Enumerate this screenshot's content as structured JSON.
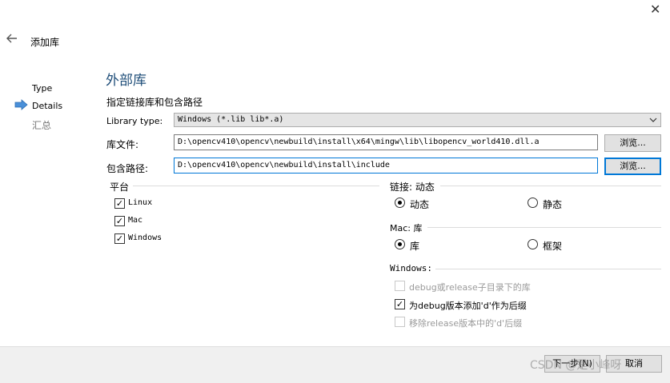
{
  "window": {
    "close_glyph": "✕",
    "title": "添加库",
    "back_glyph": "🡐"
  },
  "steps": [
    {
      "label": "Type"
    },
    {
      "label": "Details"
    },
    {
      "label": "汇总"
    }
  ],
  "page": {
    "heading": "外部库",
    "subtitle": "指定链接库和包含路径"
  },
  "library_type": {
    "label": "Library type:",
    "value": "Windows (*.lib lib*.a)"
  },
  "library_file": {
    "label": "库文件:",
    "value": "D:\\opencv410\\opencv\\newbuild\\install\\x64\\mingw\\lib\\libopencv_world410.dll.a",
    "browse": "浏览..."
  },
  "include_path": {
    "label": "包含路径:",
    "value": "D:\\opencv410\\opencv\\newbuild\\install\\include",
    "browse": "浏览..."
  },
  "platform": {
    "title": "平台",
    "items": [
      {
        "label": "Linux",
        "checked": true
      },
      {
        "label": "Mac",
        "checked": true
      },
      {
        "label": "Windows",
        "checked": true
      }
    ]
  },
  "linkage": {
    "title": "链接: 动态",
    "options": [
      {
        "label": "动态",
        "selected": true
      },
      {
        "label": "静态",
        "selected": false
      }
    ]
  },
  "mac": {
    "title": "Mac: 库",
    "options": [
      {
        "label": "库",
        "selected": true
      },
      {
        "label": "框架",
        "selected": false
      }
    ]
  },
  "windows_opts": {
    "title": "Windows:",
    "items": [
      {
        "label": "debug或release子目录下的库",
        "checked": false,
        "enabled": false
      },
      {
        "label": "为debug版本添加'd'作为后缀",
        "checked": true,
        "enabled": true
      },
      {
        "label": "移除release版本中的'd'后缀",
        "checked": false,
        "enabled": false
      }
    ]
  },
  "footer": {
    "next": "下一步(N)",
    "cancel": "取消",
    "watermark": "CSDN @是小峰呀"
  },
  "icons": {
    "step_current": "arrow-right-icon",
    "check": "✓"
  }
}
